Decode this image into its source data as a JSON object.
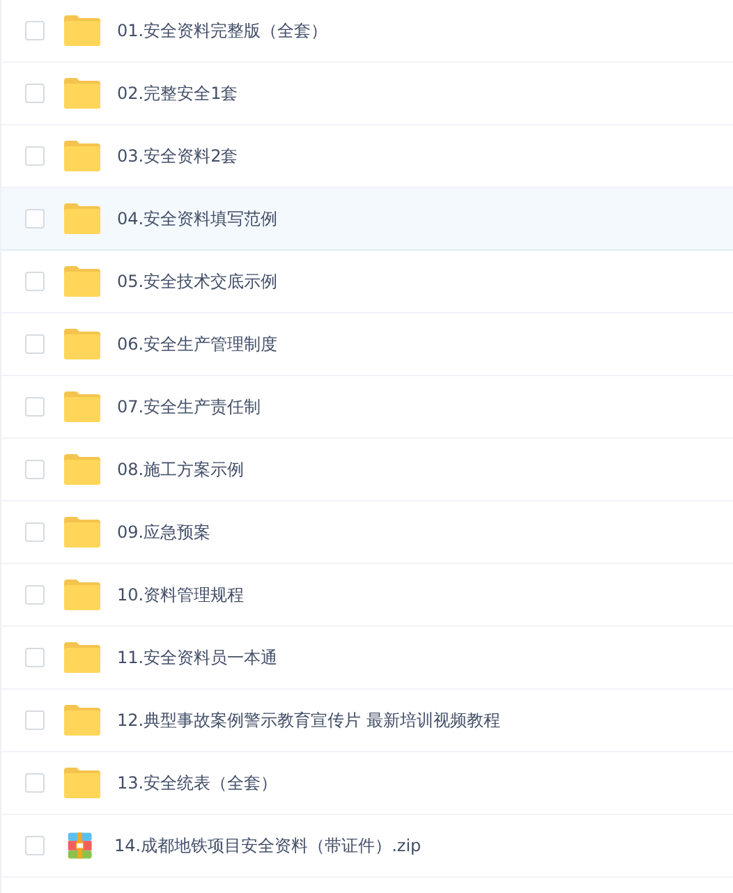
{
  "files": [
    {
      "name": "01.安全资料完整版（全套）",
      "kind": "folder",
      "checked": false,
      "highlighted": false
    },
    {
      "name": "02.完整安全1套",
      "kind": "folder",
      "checked": false,
      "highlighted": false
    },
    {
      "name": "03.安全资料2套",
      "kind": "folder",
      "checked": false,
      "highlighted": false
    },
    {
      "name": "04.安全资料填写范例",
      "kind": "folder",
      "checked": false,
      "highlighted": true
    },
    {
      "name": "05.安全技术交底示例",
      "kind": "folder",
      "checked": false,
      "highlighted": false
    },
    {
      "name": "06.安全生产管理制度",
      "kind": "folder",
      "checked": false,
      "highlighted": false
    },
    {
      "name": "07.安全生产责任制",
      "kind": "folder",
      "checked": false,
      "highlighted": false
    },
    {
      "name": "08.施工方案示例",
      "kind": "folder",
      "checked": false,
      "highlighted": false
    },
    {
      "name": "09.应急预案",
      "kind": "folder",
      "checked": false,
      "highlighted": false
    },
    {
      "name": "10.资料管理规程",
      "kind": "folder",
      "checked": false,
      "highlighted": false
    },
    {
      "name": "11.安全资料员一本通",
      "kind": "folder",
      "checked": false,
      "highlighted": false
    },
    {
      "name": "12.典型事故案例警示教育宣传片 最新培训视频教程",
      "kind": "folder",
      "checked": false,
      "highlighted": false
    },
    {
      "name": "13.安全统表（全套）",
      "kind": "folder",
      "checked": false,
      "highlighted": false
    },
    {
      "name": "14.成都地铁项目安全资料（带证件）.zip",
      "kind": "archive",
      "checked": false,
      "highlighted": false
    }
  ]
}
